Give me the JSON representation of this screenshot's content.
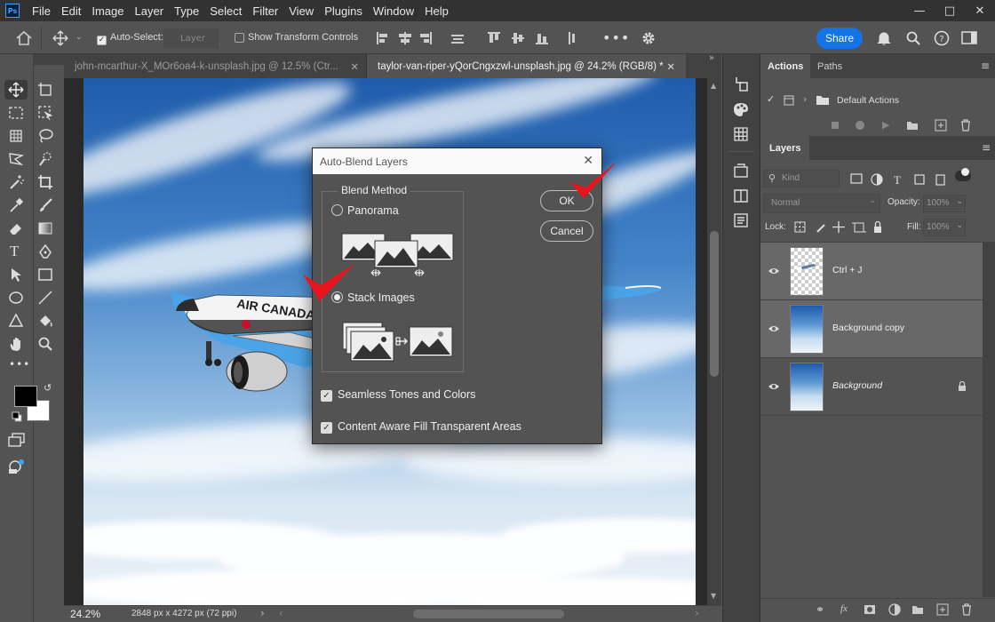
{
  "app": {
    "logo": "Ps"
  },
  "menu": [
    "File",
    "Edit",
    "Image",
    "Layer",
    "Type",
    "Select",
    "Filter",
    "View",
    "Plugins",
    "Window",
    "Help"
  ],
  "options": {
    "auto_select_label": "Auto-Select:",
    "auto_select_target": "Layer",
    "transform_label": "Show Transform Controls",
    "share_label": "Share"
  },
  "tabs": [
    {
      "label": "john-mcarthur-X_MOr6oa4-k-unsplash.jpg @ 12.5% (Ctr..."
    },
    {
      "label": "taylor-van-riper-yQorCngxzwl-unsplash.jpg @ 24.2% (RGB/8) *"
    }
  ],
  "status": {
    "zoom": "24.2%",
    "doc_info": "2848 px x 4272 px (72 ppi)"
  },
  "actions_panel": {
    "tabs": [
      "Actions",
      "Paths"
    ],
    "default_set": "Default Actions"
  },
  "layers_panel": {
    "title": "Layers",
    "filter_kind": "Kind",
    "blend_mode": "Normal",
    "opacity_label": "Opacity:",
    "opacity_value": "100%",
    "lock_label": "Lock:",
    "fill_label": "Fill:",
    "fill_value": "100%",
    "layers": [
      {
        "name": "Ctrl + J"
      },
      {
        "name": "Background copy"
      },
      {
        "name": "Background"
      }
    ]
  },
  "dialog": {
    "title": "Auto-Blend Layers",
    "group_label": "Blend Method",
    "option_panorama": "Panorama",
    "option_stack": "Stack Images",
    "selected": "Stack Images",
    "seamless_label": "Seamless Tones and Colors",
    "seamless_checked": true,
    "content_aware_label": "Content Aware Fill Transparent Areas",
    "content_aware_checked": true,
    "ok_label": "OK",
    "cancel_label": "Cancel"
  },
  "colors": {
    "accent": "#1473e6",
    "annotation_check": "#e8141e"
  },
  "artwork": {
    "aircraft_livery": "AIR CANADA"
  }
}
